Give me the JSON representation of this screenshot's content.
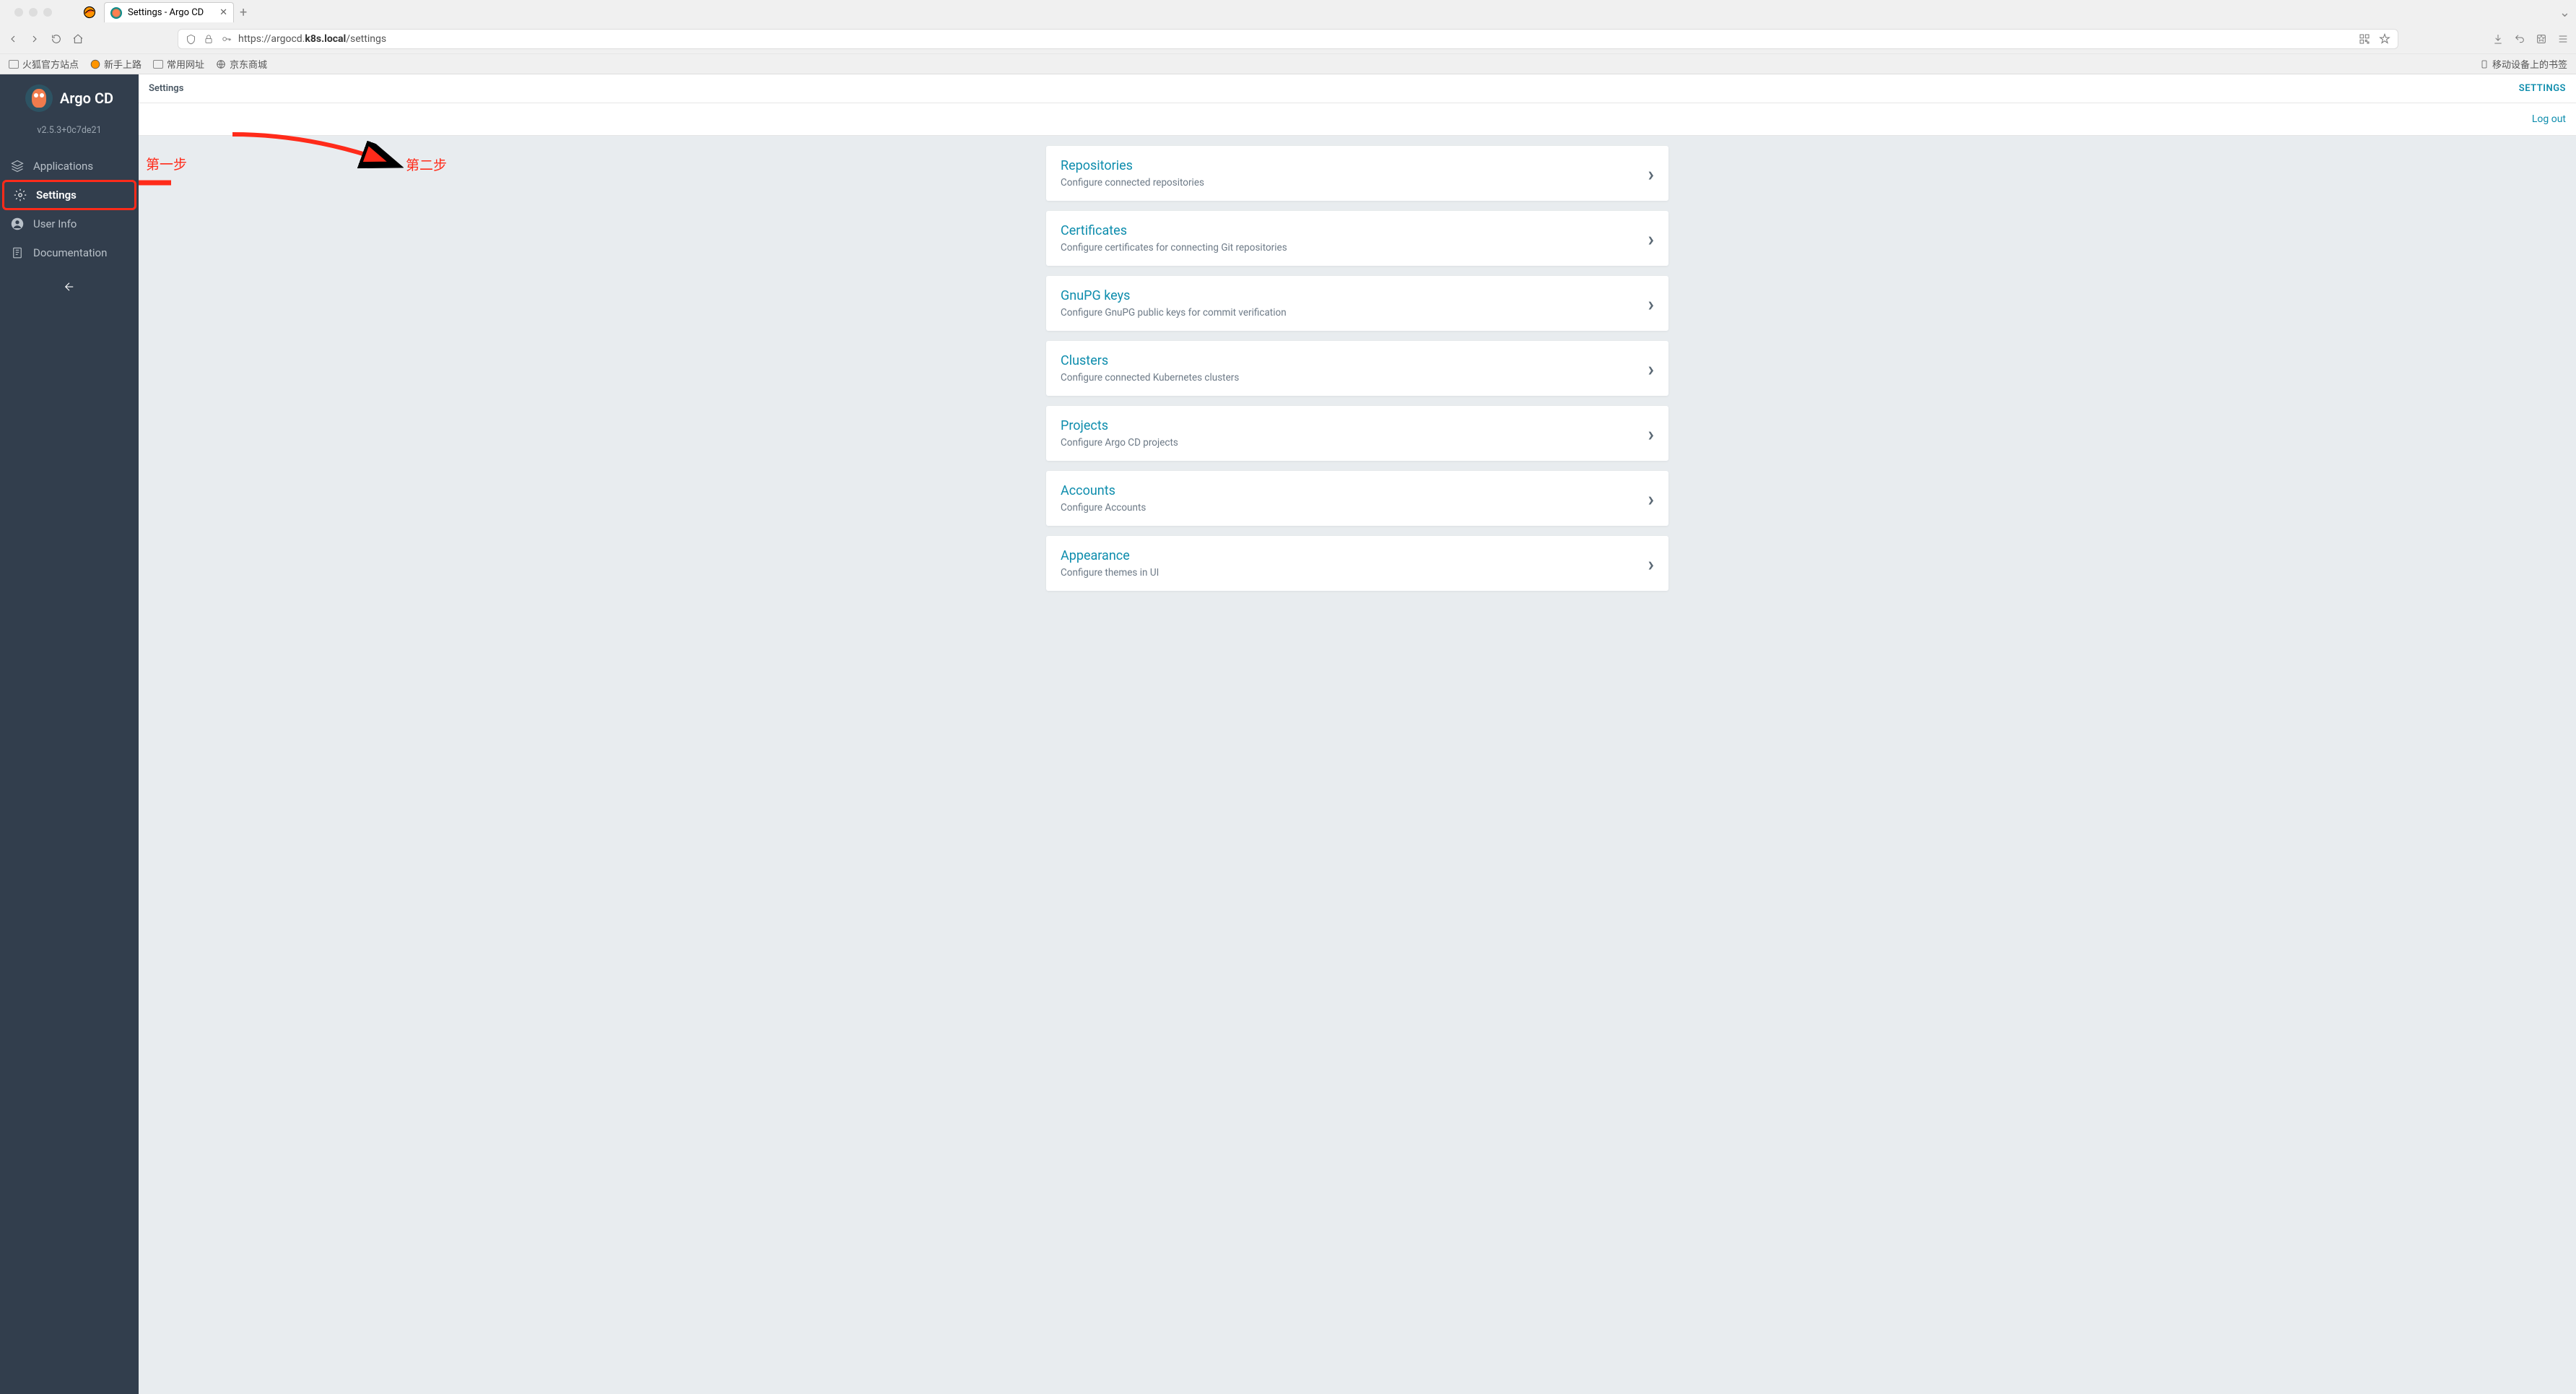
{
  "browser": {
    "tab_title": "Settings - Argo CD",
    "url_prefix": "https://argocd.",
    "url_bold": "k8s.local",
    "url_suffix": "/settings",
    "bookmarks": [
      "火狐官方站点",
      "新手上路",
      "常用网址",
      "京东商城"
    ],
    "mobile_bookmarks": "移动设备上的书签"
  },
  "sidebar": {
    "app_name": "Argo CD",
    "version": "v2.5.3+0c7de21",
    "items": [
      {
        "label": "Applications"
      },
      {
        "label": "Settings"
      },
      {
        "label": "User Info"
      },
      {
        "label": "Documentation"
      }
    ]
  },
  "header": {
    "breadcrumb": "Settings",
    "settings_link": "SETTINGS",
    "logout": "Log out"
  },
  "cards": [
    {
      "title": "Repositories",
      "desc": "Configure connected repositories"
    },
    {
      "title": "Certificates",
      "desc": "Configure certificates for connecting Git repositories"
    },
    {
      "title": "GnuPG keys",
      "desc": "Configure GnuPG public keys for commit verification"
    },
    {
      "title": "Clusters",
      "desc": "Configure connected Kubernetes clusters"
    },
    {
      "title": "Projects",
      "desc": "Configure Argo CD projects"
    },
    {
      "title": "Accounts",
      "desc": "Configure Accounts"
    },
    {
      "title": "Appearance",
      "desc": "Configure themes in UI"
    }
  ],
  "annotations": {
    "step1": "第一步",
    "step2": "第二步"
  }
}
